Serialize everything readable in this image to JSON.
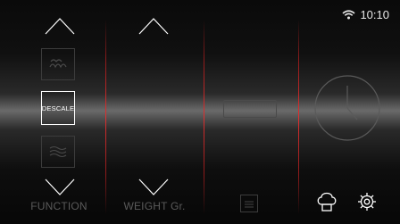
{
  "status": {
    "time": "10:10",
    "wifi_icon": "wifi-icon"
  },
  "columns": {
    "function": {
      "label": "FUNCTION",
      "selected": "DESCALE",
      "prev_icon": "steam-icon",
      "next_icon": "waves-icon"
    },
    "weight": {
      "label": "WEIGHT Gr."
    },
    "display": {
      "icon": "recipe-book-icon"
    },
    "extras": {
      "chef_icon": "chef-hat-icon",
      "settings_icon": "gear-icon"
    }
  },
  "colors": {
    "accent": "#e03030",
    "text": "#ffffff",
    "dim": "#5a5a5a"
  }
}
